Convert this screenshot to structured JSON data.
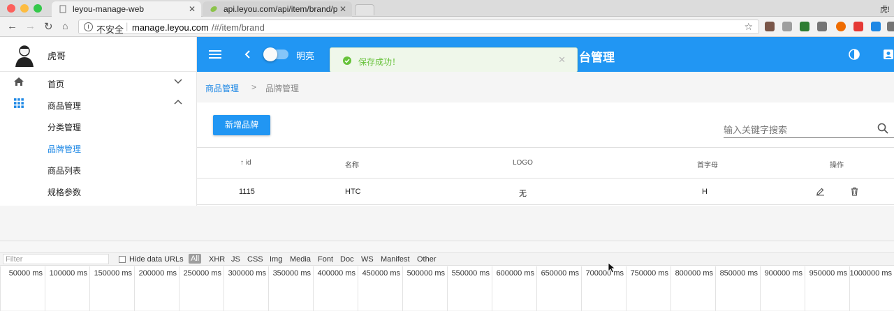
{
  "browser": {
    "tabs": [
      {
        "title": "leyou-manage-web",
        "active": true
      },
      {
        "title": "api.leyou.com/api/item/brand/p",
        "active": false
      }
    ],
    "profile_label": "虎!",
    "security_label": "不安全",
    "url_host": "manage.leyou.com",
    "url_path": "/#/item/brand"
  },
  "sidebar": {
    "user_name": "虎哥",
    "items": [
      {
        "label": "首页",
        "icon": "home-icon",
        "chevron": "⌄"
      },
      {
        "label": "商品管理",
        "icon": "apps-grid-icon",
        "chevron": "^"
      },
      {
        "label": "分类管理"
      },
      {
        "label": "品牌管理"
      },
      {
        "label": "商品列表"
      },
      {
        "label": "规格参数"
      }
    ]
  },
  "appbar": {
    "toggle_label": "明亮",
    "title": "台管理"
  },
  "toast": {
    "message": "保存成功！"
  },
  "breadcrumb": {
    "parent": "商品管理",
    "separator": ">",
    "current": "品牌管理"
  },
  "toolbar": {
    "add_label": "新增品牌",
    "search_placeholder": "输入关键字搜索"
  },
  "table": {
    "headers": [
      "↑ id",
      "名称",
      "LOGO",
      "首字母",
      "操作"
    ],
    "rows": [
      {
        "id": "1115",
        "name": "HTC",
        "logo": "无",
        "letter": "H"
      }
    ]
  },
  "devtools": {
    "filter_placeholder": "Filter",
    "hide_data_urls": "Hide data URLs",
    "types": [
      "All",
      "XHR",
      "JS",
      "CSS",
      "Img",
      "Media",
      "Font",
      "Doc",
      "WS",
      "Manifest",
      "Other"
    ],
    "ticks": [
      "50000 ms",
      "100000 ms",
      "150000 ms",
      "200000 ms",
      "250000 ms",
      "300000 ms",
      "350000 ms",
      "400000 ms",
      "450000 ms",
      "500000 ms",
      "550000 ms",
      "600000 ms",
      "650000 ms",
      "700000 ms",
      "750000 ms",
      "800000 ms",
      "850000 ms",
      "900000 ms",
      "950000 ms",
      "1000000 ms"
    ]
  },
  "colors": {
    "primary": "#2196f3",
    "accent_link": "#1e88e5",
    "toast_green": "#67c23a"
  }
}
